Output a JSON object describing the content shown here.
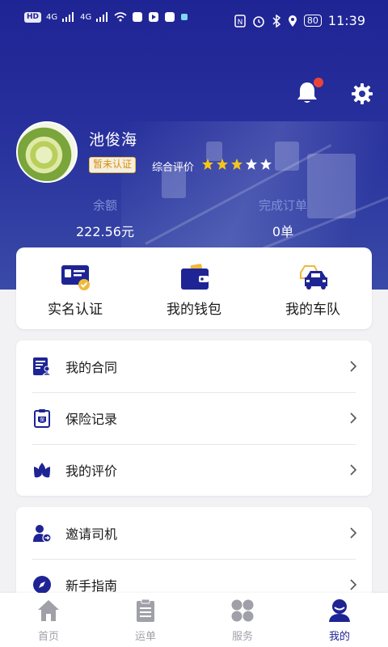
{
  "status_bar": {
    "left_items": [
      "HD",
      "4G",
      "4G"
    ],
    "battery": "80",
    "time": "11:39"
  },
  "header": {
    "notification_badge": true
  },
  "profile": {
    "name": "池俊海",
    "verify_badge": "暂未认证",
    "rating_label": "综合评价",
    "rating": {
      "filled": 3,
      "total": 5
    },
    "colors": {
      "star_filled": "#f5c518",
      "star_empty": "#ffffff"
    }
  },
  "stats": {
    "balance": {
      "label": "余额",
      "value": "222.56元"
    },
    "orders": {
      "label": "完成订单",
      "value": "0单"
    }
  },
  "quick_actions": [
    {
      "label": "实名认证",
      "icon": "id-card-icon"
    },
    {
      "label": "我的钱包",
      "icon": "wallet-icon"
    },
    {
      "label": "我的车队",
      "icon": "fleet-icon"
    }
  ],
  "menu_group_1": [
    {
      "label": "我的合同",
      "icon": "contract-icon"
    },
    {
      "label": "保险记录",
      "icon": "insurance-icon"
    },
    {
      "label": "我的评价",
      "icon": "evaluation-icon"
    }
  ],
  "menu_group_2": [
    {
      "label": "邀请司机",
      "icon": "invite-driver-icon"
    },
    {
      "label": "新手指南",
      "icon": "compass-icon"
    }
  ],
  "bottom_nav": [
    {
      "label": "首页",
      "icon": "home-icon",
      "active": false
    },
    {
      "label": "运单",
      "icon": "waybill-icon",
      "active": false
    },
    {
      "label": "服务",
      "icon": "service-icon",
      "active": false
    },
    {
      "label": "我的",
      "icon": "profile-icon",
      "active": true
    }
  ],
  "colors": {
    "brand": "#1f2494",
    "accent_yellow": "#f0b93b",
    "notification_red": "#e9443b",
    "inactive_nav": "#a0a0a8"
  }
}
